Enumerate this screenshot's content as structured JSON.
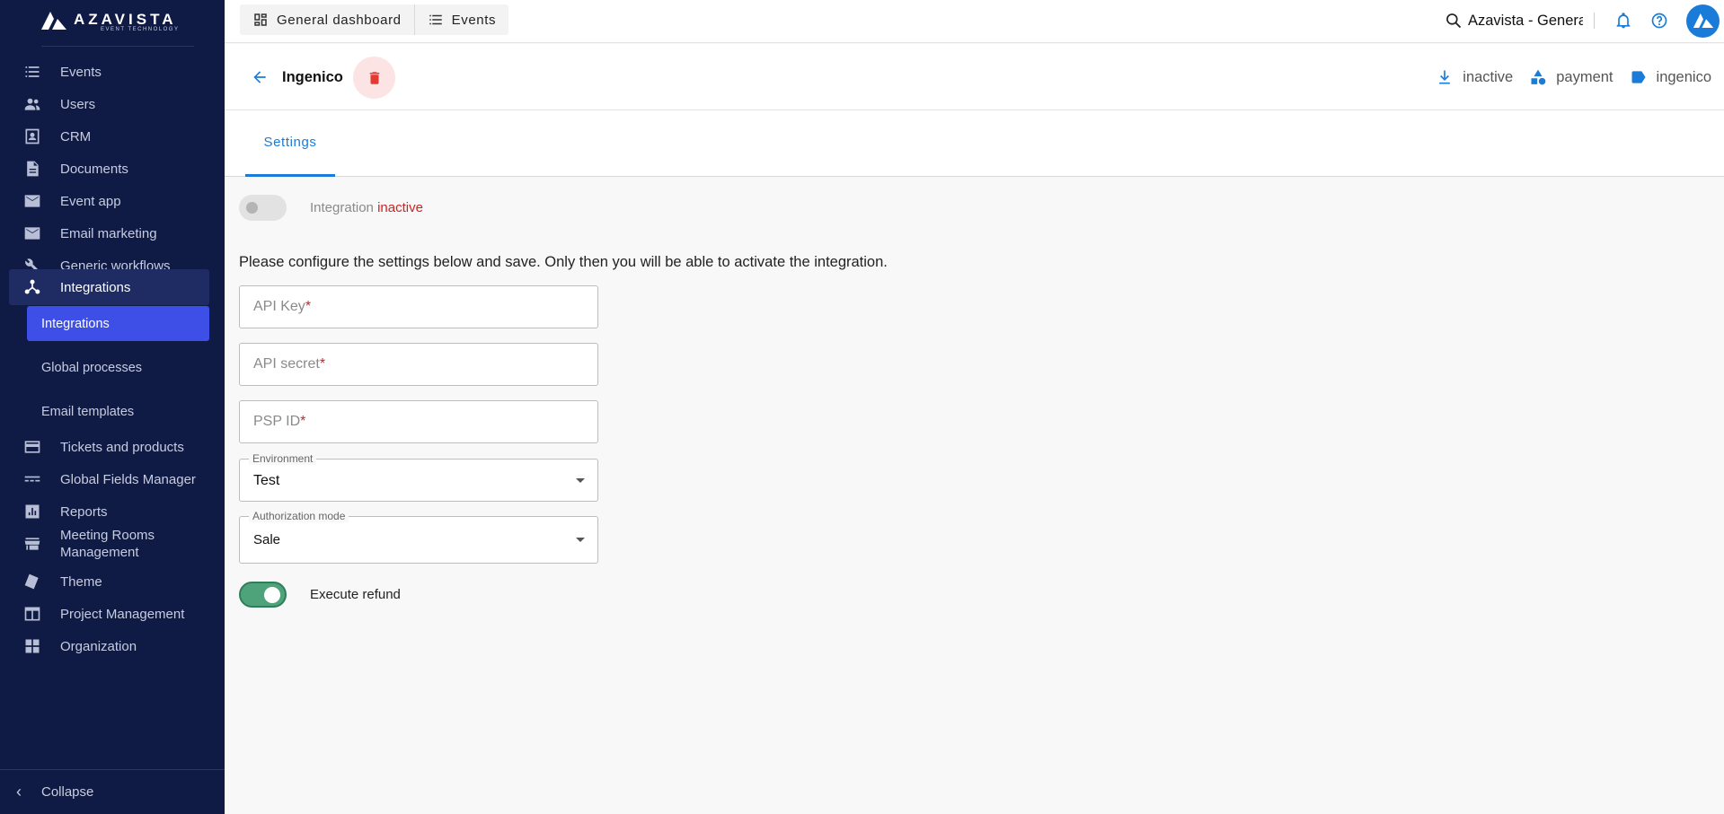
{
  "brand": {
    "name": "AZAVISTA",
    "tagline": "EVENT TECHNOLOGY"
  },
  "sidebar": {
    "items": [
      {
        "label": "Events",
        "icon": "list-icon"
      },
      {
        "label": "Users",
        "icon": "users-icon"
      },
      {
        "label": "CRM",
        "icon": "contact-card-icon"
      },
      {
        "label": "Documents",
        "icon": "document-icon"
      },
      {
        "label": "Event app",
        "icon": "mail-icon"
      },
      {
        "label": "Email marketing",
        "icon": "mail-icon"
      },
      {
        "label": "Generic workflows",
        "icon": "wrench-icon"
      },
      {
        "label": "Integrations",
        "icon": "hub-icon"
      },
      {
        "label": "Tickets and products",
        "icon": "card-icon"
      },
      {
        "label": "Global Fields Manager",
        "icon": "fields-icon"
      },
      {
        "label": "Reports",
        "icon": "chart-icon"
      },
      {
        "label": "Meeting Rooms Management",
        "icon": "store-icon"
      },
      {
        "label": "Theme",
        "icon": "theme-icon"
      },
      {
        "label": "Project Management",
        "icon": "layout-icon"
      },
      {
        "label": "Organization",
        "icon": "grid-icon"
      }
    ],
    "sub_items": [
      {
        "label": "Integrations"
      },
      {
        "label": "Global processes"
      },
      {
        "label": "Email templates"
      }
    ],
    "collapse_label": "Collapse"
  },
  "topbar": {
    "tabs": [
      {
        "label": "General dashboard",
        "icon": "dashboard-icon"
      },
      {
        "label": "Events",
        "icon": "list-icon"
      }
    ],
    "org_name": "Azavista - General"
  },
  "header": {
    "title": "Ingenico",
    "badges": [
      {
        "label": "inactive",
        "icon": "download-icon"
      },
      {
        "label": "payment",
        "icon": "category-icon"
      },
      {
        "label": "ingenico",
        "icon": "tag-icon"
      }
    ]
  },
  "tabs": [
    {
      "label": "Settings"
    }
  ],
  "settings": {
    "integration_label": "Integration",
    "integration_state": "inactive",
    "info_text": "Please configure the settings below and save. Only then you will be able to activate the integration.",
    "fields": [
      {
        "placeholder": "API Key",
        "required": "*"
      },
      {
        "placeholder": "API secret",
        "required": "*"
      },
      {
        "placeholder": "PSP ID",
        "required": "*"
      }
    ],
    "environment": {
      "label": "Environment",
      "value": "Test"
    },
    "authorization": {
      "label": "Authorization mode",
      "value": "Sale"
    },
    "refund_label": "Execute refund"
  },
  "colors": {
    "sidebar_bg": "#0f1b44",
    "accent": "#1a7bd8",
    "active_sub": "#3d4fe6",
    "danger": "#d42020",
    "toggle_on": "#4fa37b"
  }
}
